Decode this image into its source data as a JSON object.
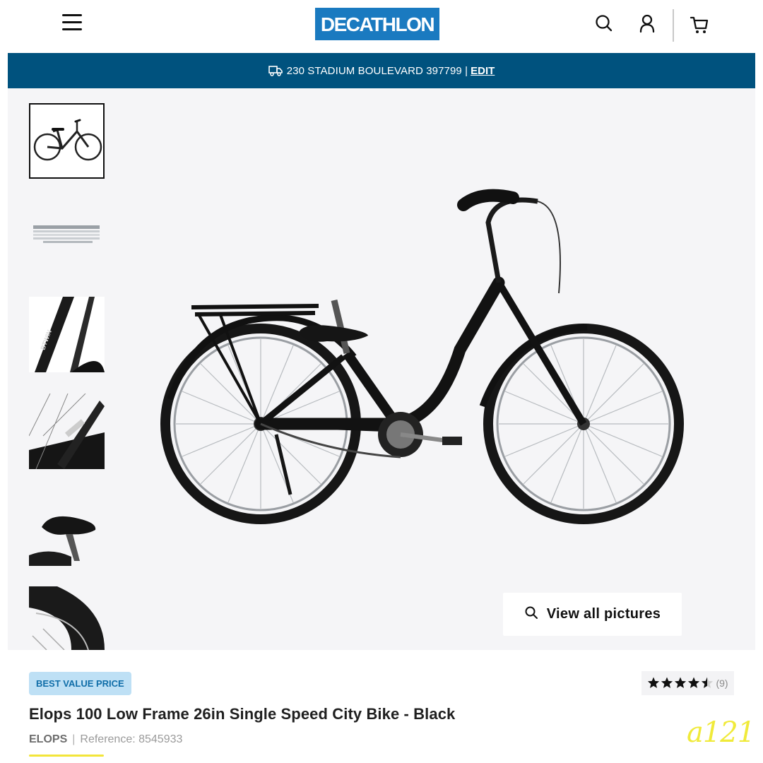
{
  "header": {
    "menu_icon": "hamburger-menu-icon",
    "logo_text": "DECATHLON",
    "brand_color": "#1a7ac0",
    "icons": [
      "search-icon",
      "account-icon",
      "cart-icon"
    ]
  },
  "delivery": {
    "icon": "truck-icon",
    "address": "230 STADIUM BOULEVARD 397799 |",
    "edit_label": "EDIT",
    "background": "#00527e"
  },
  "gallery": {
    "selected_index": 0,
    "thumbnails": [
      "bike-full-view",
      "size-chart",
      "frame-closeup",
      "frame-detail",
      "saddle-closeup",
      "tyre-closeup"
    ],
    "view_all_label": "View all pictures"
  },
  "product": {
    "badge": "BEST VALUE PRICE",
    "rating_value": 4.5,
    "rating_max": 5,
    "rating_count": "(9)",
    "title": "Elops 100 Low Frame 26in Single Speed City Bike - Black",
    "brand": "ELOPS",
    "separator": "|",
    "reference": "Reference: 8545933"
  },
  "watermark": "a121"
}
